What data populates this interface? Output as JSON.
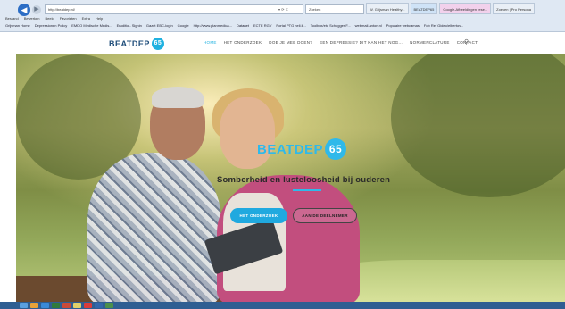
{
  "browser": {
    "address": "http://beatdep.nl/",
    "address_controls": "▾ ⟳ ✕",
    "search_placeholder": "Zoeken",
    "tabs": [
      {
        "label": "W. Grijsman Healthy..."
      },
      {
        "label": "BEATDEP65"
      },
      {
        "label": "Google-Afbeeldingen rese..."
      },
      {
        "label": "Zoeken | Pro Persona"
      }
    ],
    "menu": [
      "Bestand",
      "Bewerken",
      "Beeld",
      "Favorieten",
      "Extra",
      "Help"
    ],
    "favorites": [
      "Grijsman Home",
      "Depressionen Policy",
      "EMDO Medische Medis...",
      "Eruditio - Signin",
      "Gazet EBC-login",
      "Google",
      "http://www.planmedica...",
      "Datanet",
      "ECTE RGV",
      "Portal PTG heli.li...",
      "Toolbox/etc Schogger F...",
      "webmail.anton.nl",
      "Populaire webcamas",
      "Fob Ref Gideo/elbertov..."
    ]
  },
  "site": {
    "logo_text": "BEATDEP",
    "logo_number": "65",
    "nav": [
      {
        "label": "HOME",
        "active": true
      },
      {
        "label": "HET ONDERZOEK",
        "active": false
      },
      {
        "label": "DOE JE MEE DOEN?",
        "active": false
      },
      {
        "label": "EEN DEPRESSIE? DIT KAN HET NOG...",
        "active": false
      },
      {
        "label": "NORMENCLATURE",
        "active": false
      },
      {
        "label": "CONTACT",
        "active": false
      }
    ],
    "search_icon": "search-icon",
    "hero": {
      "logo_text": "BEATDEP",
      "logo_number": "65",
      "tagline": "Somberheid en lusteloosheid bij ouderen",
      "primary_button": "HET ONDERZOEK",
      "secondary_button": "AAN DE DEELNEMER"
    }
  },
  "colors": {
    "accent": "#20a9df",
    "logo_dark": "#1f4d7a",
    "taskbar": "#2f5e92"
  }
}
